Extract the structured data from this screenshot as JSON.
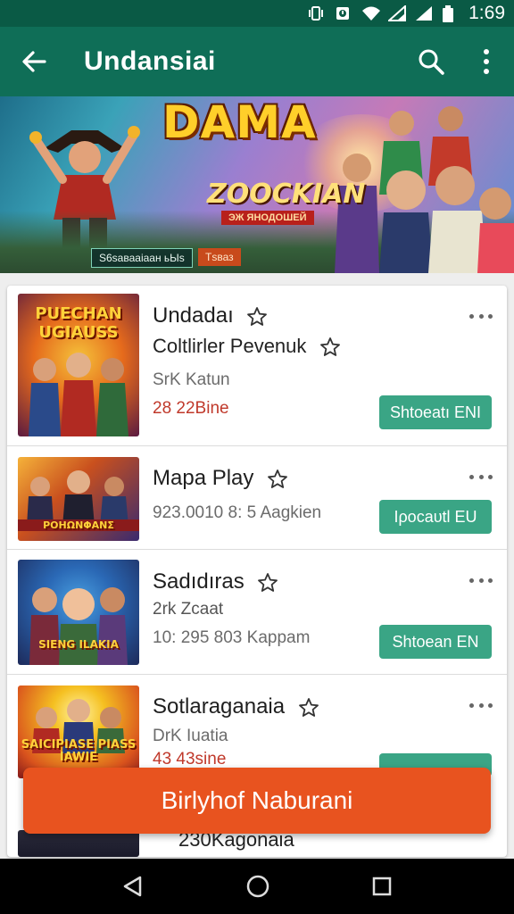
{
  "status_bar": {
    "time": "1:69"
  },
  "app_bar": {
    "title": "Undansiai",
    "back_icon": "arrow-left-icon",
    "search_icon": "search-icon",
    "more_icon": "more-vert-icon"
  },
  "banner": {
    "logo_line1": "DAMA",
    "logo_line2": "ZOOCKIAN",
    "logo_ribbon": "ЭЖ ЯНОДОШЕЙ",
    "tag_left": "Ѕ6ѕавааіаан ьЫѕ",
    "tag_right": "Тѕваз"
  },
  "list": [
    {
      "name": "Undadaı",
      "subtitle": "Coltlirler Pevenuk",
      "meta": "SrK Katun",
      "red_meta": "28  22Bine",
      "button": "Shtoeatı ENI",
      "thumb_art": "PUECHAN UGIAUSS",
      "thumb_colors": [
        "#f2a21c",
        "#d9361d",
        "#2a2f7a"
      ]
    },
    {
      "name": "Mapa Play",
      "meta": "923.0010 8: 5 Aagkien",
      "button": "Ιροcaυtl EU",
      "thumb_art": "ΡΟΗΩΝΦΑΝΣ",
      "thumb_colors": [
        "#f5b23a",
        "#3a2a6e",
        "#b0331f"
      ]
    },
    {
      "name": "Sadıdıras",
      "subtitle_meta": "2rk Zcaat",
      "meta": "10: 295 803 Kappam",
      "button": "Shtoean EN",
      "thumb_art": "SIENG ILAKIA",
      "thumb_colors": [
        "#2a68b5",
        "#f0a030",
        "#1d2a5a"
      ]
    },
    {
      "name": "Sotlaraganaia",
      "meta": "DrK Iuatia",
      "red_meta": "43  43sine",
      "thumb_art": "SAICIPIASE PIASS IAWIE",
      "thumb_colors": [
        "#f5c021",
        "#d9531d",
        "#8a1b1b"
      ]
    }
  ],
  "peek_row": {
    "name": "230Kagonaia"
  },
  "cta": {
    "label": "Birlyhof Naburani"
  }
}
